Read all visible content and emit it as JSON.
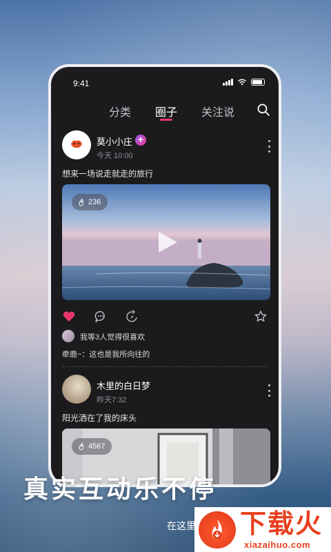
{
  "status_bar": {
    "time": "9:41"
  },
  "tabs": [
    {
      "label": "分类",
      "active": false
    },
    {
      "label": "圈子",
      "active": true
    },
    {
      "label": "关注说",
      "active": false
    }
  ],
  "accent_color": "#e8366d",
  "posts": [
    {
      "author": "莫小小庄",
      "time": "今天 10:00",
      "caption": "想来一场说走就走的旅行",
      "hot_count": "236",
      "likes_text": "我等3人觉得很喜欢",
      "comment": "牵鹿~：这也是我所向往的",
      "liked": true
    },
    {
      "author": "木里的白日梦",
      "time": "昨天7:32",
      "caption": "阳光洒在了我的床头",
      "hot_count": "4567"
    }
  ],
  "promo": {
    "headline": "真实互动乐不停",
    "subline": "在这里"
  },
  "watermark": {
    "brand_cn": "下载火",
    "brand_en": "xiazaihuo.com"
  }
}
